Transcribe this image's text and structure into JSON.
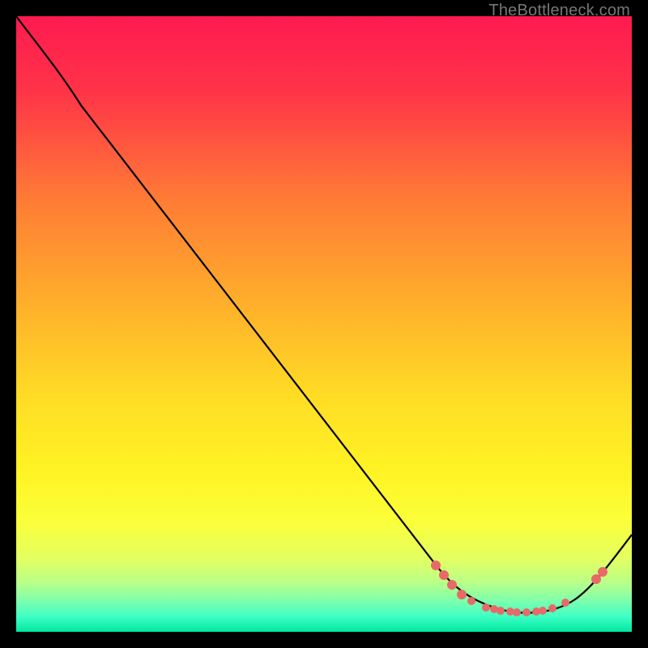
{
  "chart_data": {
    "type": "line",
    "title": "",
    "watermark": "TheBottleneck.com",
    "xlabel": "",
    "ylabel": "",
    "xlim": [
      0,
      100
    ],
    "ylim": [
      0,
      100
    ],
    "background_gradient_stops": [
      {
        "pos": 0.0,
        "color": "#ff1a50"
      },
      {
        "pos": 0.12,
        "color": "#ff3348"
      },
      {
        "pos": 0.3,
        "color": "#ff7c35"
      },
      {
        "pos": 0.48,
        "color": "#ffb32a"
      },
      {
        "pos": 0.62,
        "color": "#ffdd25"
      },
      {
        "pos": 0.74,
        "color": "#fff324"
      },
      {
        "pos": 0.82,
        "color": "#fbff3a"
      },
      {
        "pos": 0.88,
        "color": "#e4ff60"
      },
      {
        "pos": 0.92,
        "color": "#b9ff88"
      },
      {
        "pos": 0.95,
        "color": "#7dffad"
      },
      {
        "pos": 0.975,
        "color": "#3fffc4"
      },
      {
        "pos": 1.0,
        "color": "#00e8a0"
      }
    ],
    "series": [
      {
        "name": "bottleneck-curve",
        "color": "#000000",
        "x": [
          0,
          4,
          7,
          10,
          15,
          20,
          30,
          40,
          50,
          60,
          68,
          72,
          76,
          80,
          84,
          88,
          92,
          96,
          100
        ],
        "y": [
          100,
          96,
          92,
          86,
          80,
          73,
          60,
          47,
          34,
          21,
          11,
          8,
          5,
          4,
          3,
          4,
          6,
          10,
          16
        ]
      }
    ],
    "markers": {
      "name": "trough-points",
      "color": "#e86a68",
      "x": [
        68,
        69.5,
        71,
        72.4,
        74,
        76.3,
        77.6,
        78.7,
        80.3,
        81.3,
        82.9,
        84.5,
        85.5,
        87.1,
        89.2,
        94.2,
        95.3
      ],
      "y": [
        10.8,
        9.2,
        7.6,
        6.1,
        5.0,
        3.9,
        3.7,
        3.4,
        3.3,
        3.2,
        3.2,
        3.3,
        3.4,
        3.8,
        4.7,
        8.6,
        9.7
      ]
    }
  }
}
